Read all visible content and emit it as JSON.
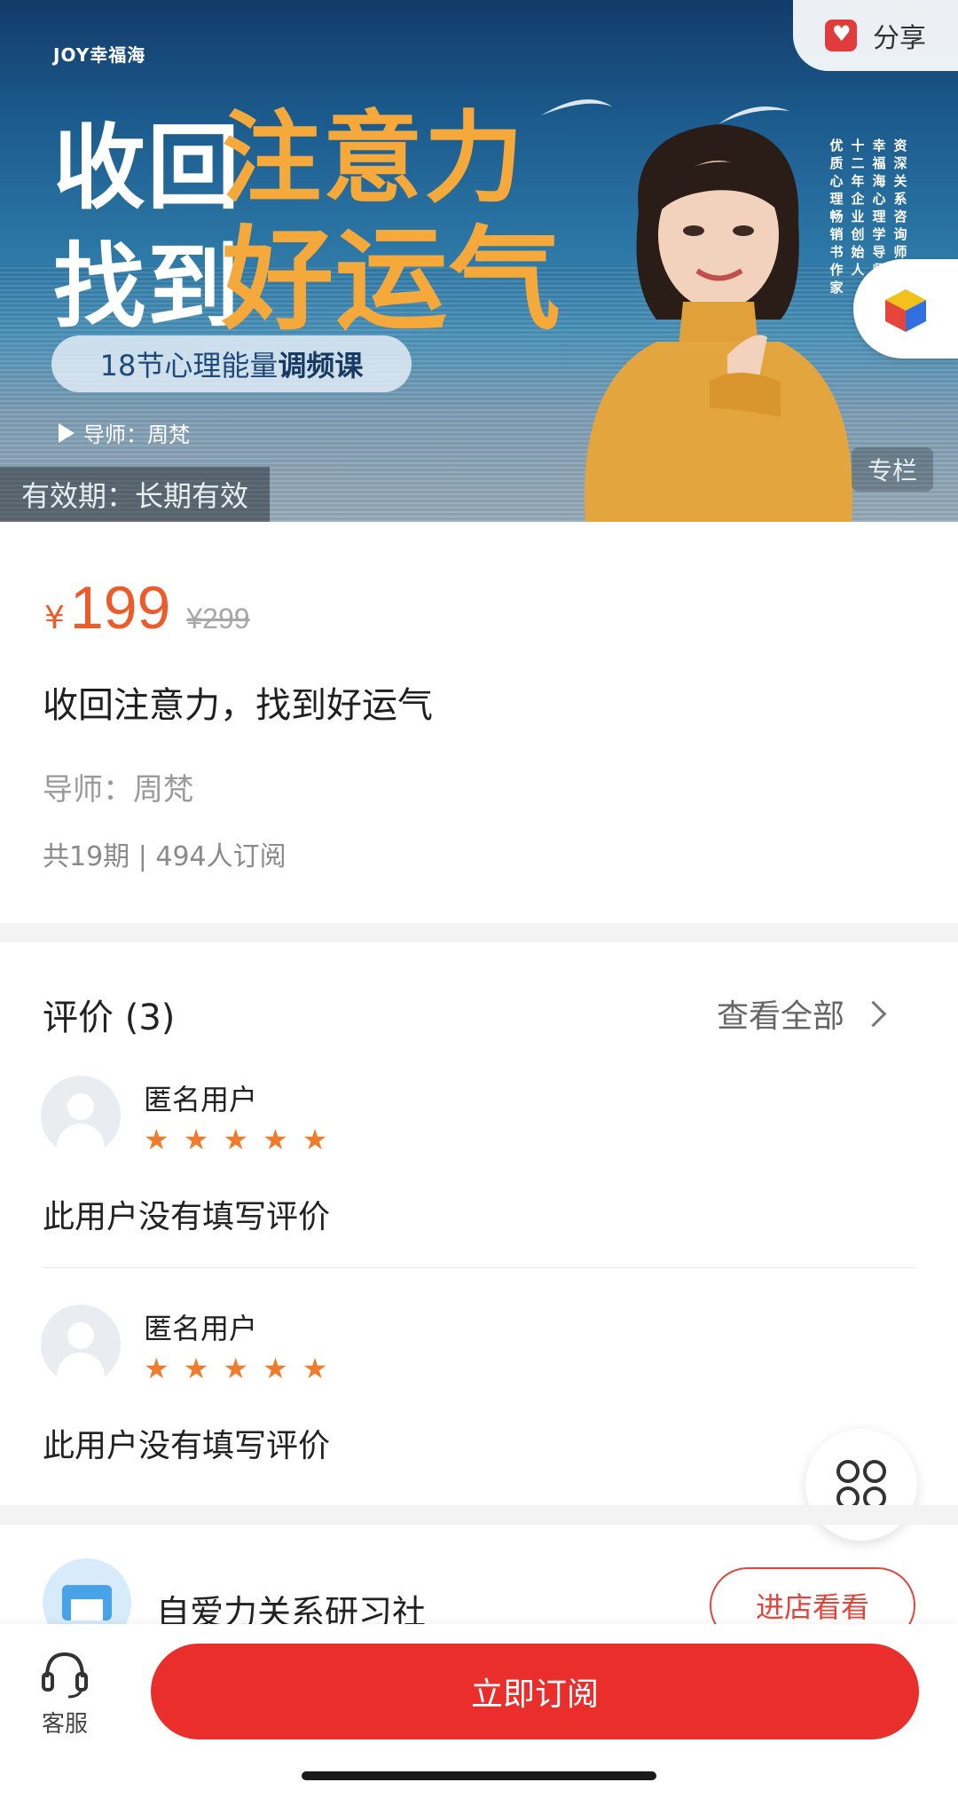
{
  "banner": {
    "brand": "JOY幸福海",
    "title_line1_white": "收回",
    "title_line1_orange": "注意力",
    "title_line2_white": "找到",
    "title_line2_orange": "好运气",
    "pill_normal": "18节心理能量",
    "pill_bold": "调频课",
    "teacher": "导师：周梵",
    "validity": "有效期：长期有效",
    "tag": "专栏",
    "share_label": "分享",
    "vertical_text": [
      "资深关系咨询师",
      "幸福海心理学导师",
      "十二年企业创始人",
      "优质心理畅销书作家"
    ]
  },
  "course": {
    "currency": "¥",
    "price": "199",
    "original_price": "¥299",
    "title": "收回注意力，找到好运气",
    "teacher_line": "导师：周梵",
    "meta": "共19期 | 494人订阅"
  },
  "reviews": {
    "title": "评价 (3)",
    "see_all": "查看全部",
    "items": [
      {
        "user": "匿名用户",
        "rating": 5,
        "text": "此用户没有填写评价"
      },
      {
        "user": "匿名用户",
        "rating": 5,
        "text": "此用户没有填写评价"
      }
    ]
  },
  "shop": {
    "name": "自爱力关系研习社",
    "button": "进店看看"
  },
  "bottom": {
    "service_label": "客服",
    "subscribe_label": "立即订阅"
  },
  "colors": {
    "accent_red": "#ea2e2b",
    "price_orange": "#ee5a2a",
    "star_orange": "#ef7b2c",
    "title_orange": "#f5a93a"
  },
  "icons": [
    "share-icon",
    "cube-icon",
    "play-icon",
    "star-icon",
    "chevron-right-icon",
    "clover-menu-icon",
    "headset-icon",
    "avatar-icon",
    "shop-icon"
  ]
}
